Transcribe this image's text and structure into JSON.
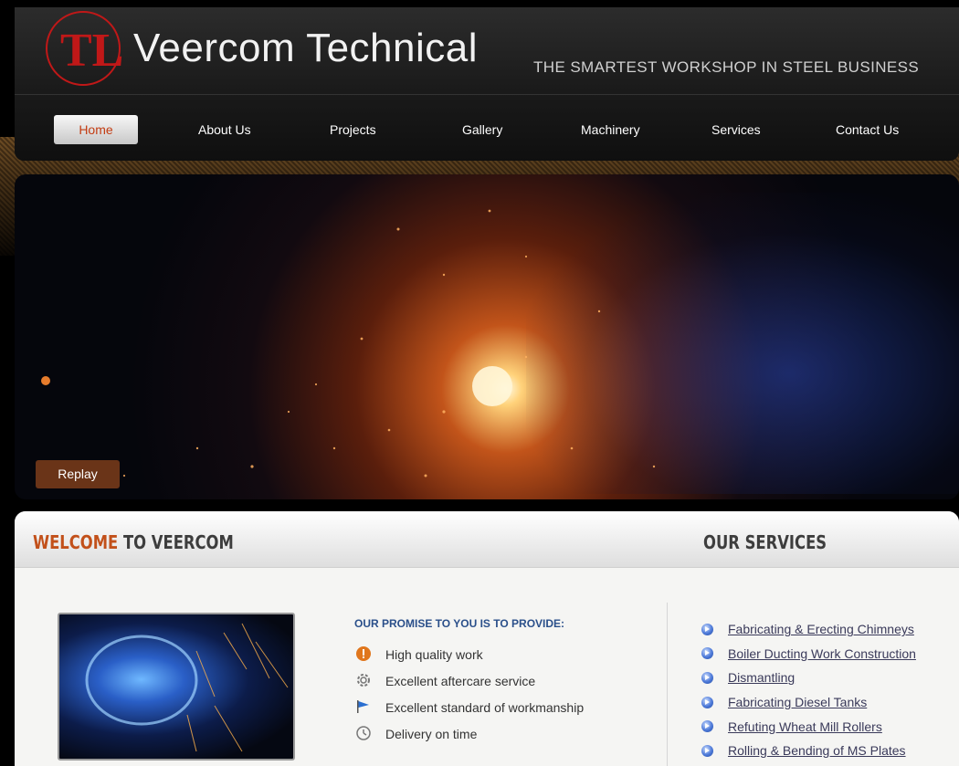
{
  "header": {
    "logo_text": "TL",
    "title": "Veercom Technical",
    "tagline": "THE SMARTEST WORKSHOP IN STEEL BUSINESS"
  },
  "nav": {
    "items": [
      {
        "label": "Home",
        "active": true
      },
      {
        "label": "About Us"
      },
      {
        "label": "Projects"
      },
      {
        "label": "Gallery"
      },
      {
        "label": "Machinery"
      },
      {
        "label": "Services"
      },
      {
        "label": "Contact Us"
      }
    ]
  },
  "hero": {
    "replay_label": "Replay"
  },
  "welcome": {
    "title_accent": "WELCOME",
    "title_rest": " TO VEERCOM",
    "promise_title": "OUR PROMISE TO YOU IS TO PROVIDE:",
    "promises": [
      {
        "text": "High quality work",
        "icon": "quality-icon"
      },
      {
        "text": "Excellent aftercare service",
        "icon": "gear-icon"
      },
      {
        "text": "Excellent standard of workmanship",
        "icon": "flag-icon"
      },
      {
        "text": "Delivery on time",
        "icon": "clock-icon"
      }
    ]
  },
  "services": {
    "title": "OUR SERVICES",
    "items": [
      "Fabricating & Erecting Chimneys",
      "Boiler Ducting Work Construction",
      "Dismantling",
      "Fabricating Diesel Tanks",
      "Refuting Wheat Mill Rollers",
      "Rolling & Bending of MS Plates"
    ]
  },
  "colors": {
    "accent": "#c2501a",
    "nav_active_text": "#c33c12",
    "promise_title": "#2a4f8a"
  }
}
